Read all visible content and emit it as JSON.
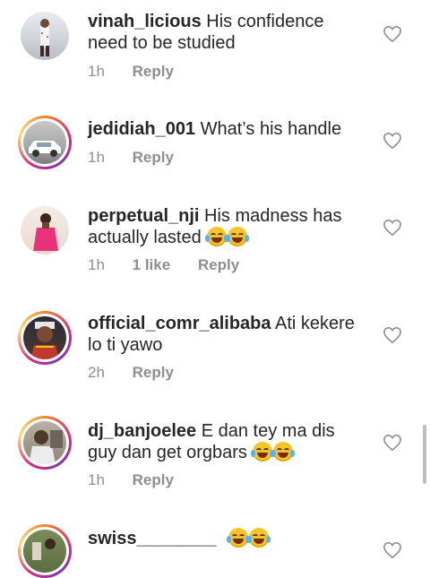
{
  "comments": [
    {
      "username": "vinah_licious",
      "text": "His confidence need to be studied",
      "time": "1h",
      "likes": "",
      "reply": "Reply",
      "emoji_count": 0
    },
    {
      "username": "jedidiah_001",
      "text": "What’s his handle",
      "time": "1h",
      "likes": "",
      "reply": "Reply",
      "emoji_count": 0
    },
    {
      "username": "perpetual_nji",
      "text": "His madness has actually lasted",
      "time": "1h",
      "likes": "1 like",
      "reply": "Reply",
      "emoji_count": 2
    },
    {
      "username": "official_comr_alibaba",
      "text": "Ati kekere lo ti yawo",
      "time": "2h",
      "likes": "",
      "reply": "Reply",
      "emoji_count": 0
    },
    {
      "username": "dj_banjoelee",
      "text": "E dan tey ma dis guy dan get orgbars",
      "time": "1h",
      "likes": "",
      "reply": "Reply",
      "emoji_count": 2
    },
    {
      "username": "swiss________",
      "text": "",
      "time": "",
      "likes": "",
      "reply": "",
      "emoji_count": 2
    }
  ],
  "icons": {
    "like": "heart-outline-icon",
    "emoji": "face-with-tears-of-joy"
  },
  "colors": {
    "text": "#262626",
    "meta": "#8e8e8e",
    "story_ring": "#dd2a7b"
  }
}
